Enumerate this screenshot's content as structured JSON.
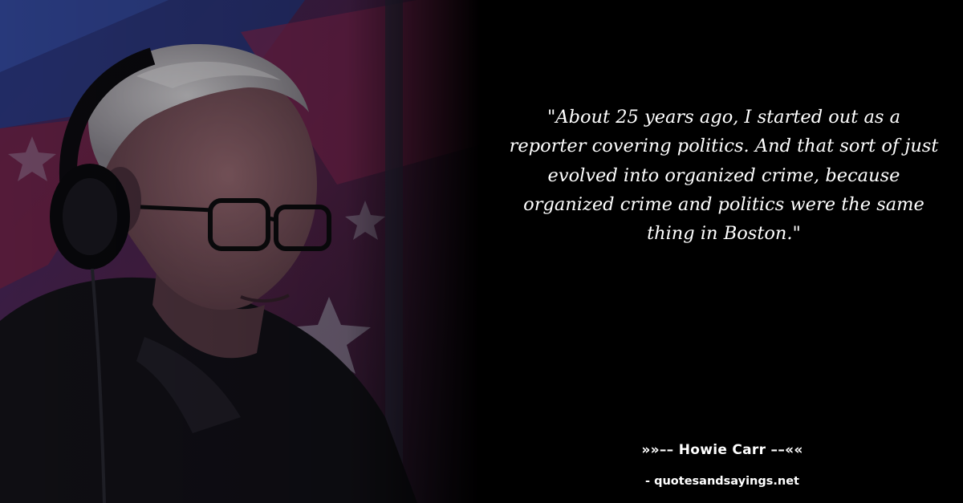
{
  "photo": {
    "subject": "man-with-headphones-and-glasses"
  },
  "quote": {
    "text": "\"About 25 years ago, I started out as a reporter covering politics. And that sort of just evolved into organized crime, because organized crime and politics were the same thing in Boston.\""
  },
  "attribution": {
    "author": "»»–– Howie Carr ––««",
    "source": "- quotesandsayings.net"
  },
  "colors": {
    "background": "#000000",
    "text": "#ffffff",
    "backdrop_blue": "#1e2a6e",
    "backdrop_red": "#7a1f45"
  }
}
